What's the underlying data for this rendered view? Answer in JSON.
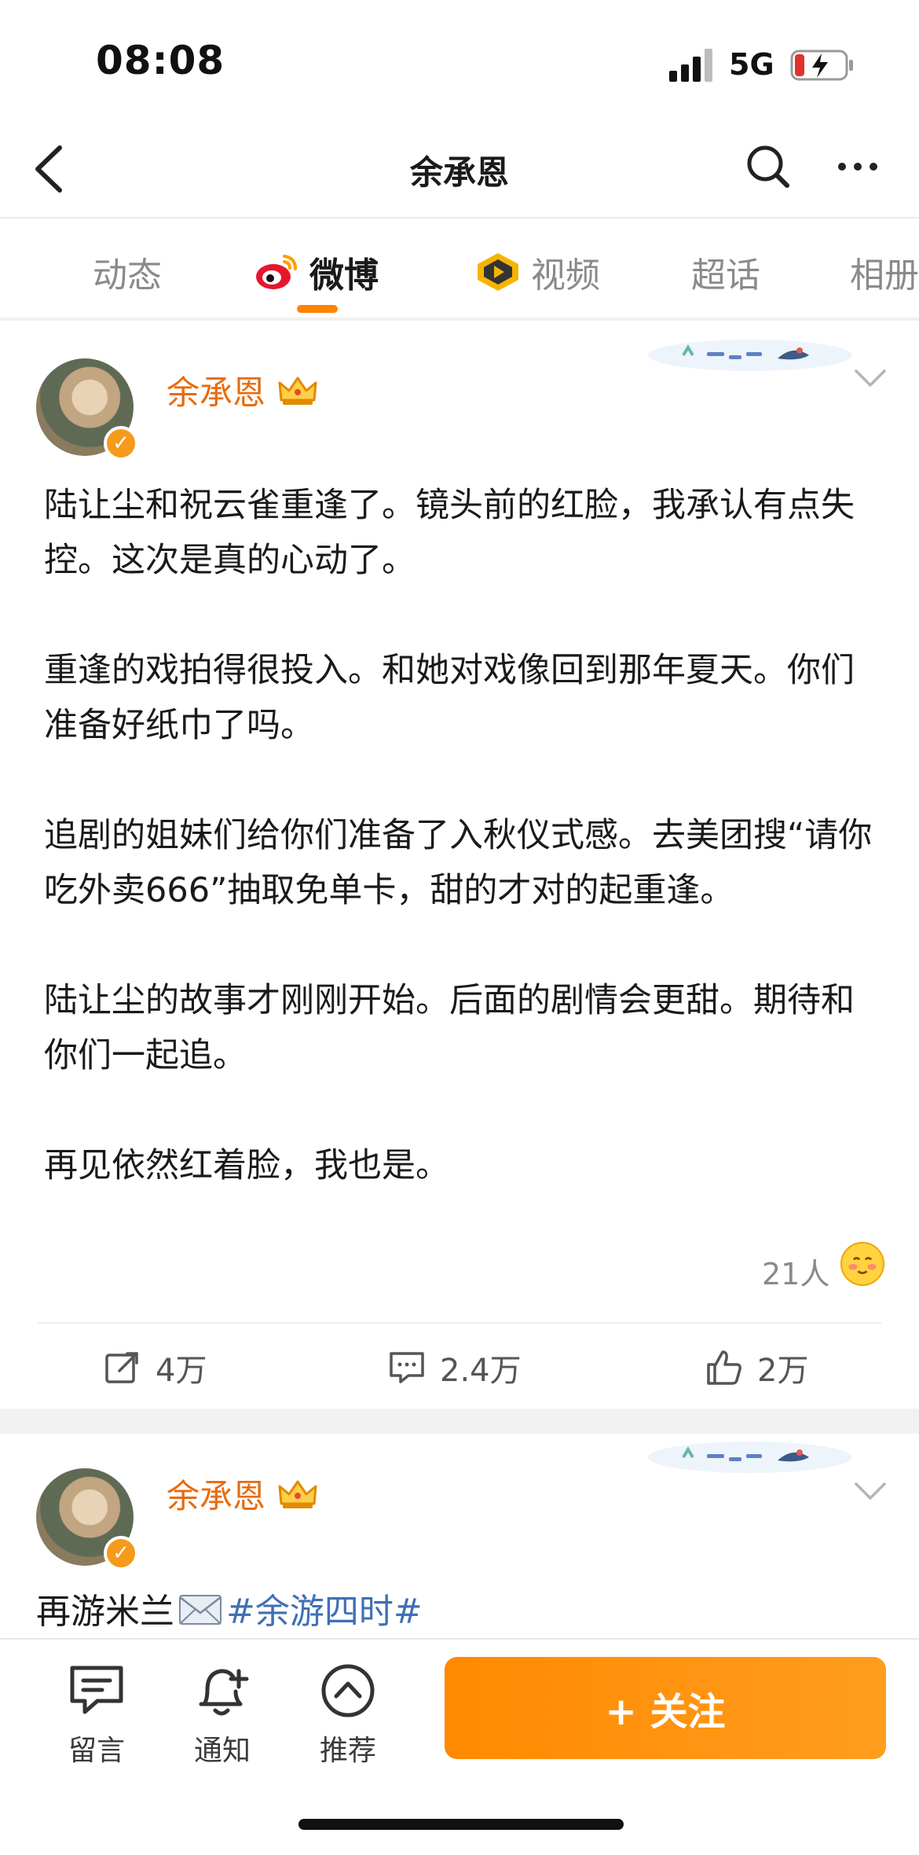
{
  "status_bar": {
    "time": "08:08",
    "network": "5G"
  },
  "nav": {
    "title": "余承恩"
  },
  "tabs": [
    {
      "label": "动态"
    },
    {
      "label": "微博"
    },
    {
      "label": "视频"
    },
    {
      "label": "超话"
    },
    {
      "label": "相册"
    }
  ],
  "post1": {
    "author": "余承恩",
    "paragraphs": [
      "陆让尘和祝云雀重逢了。镜头前的红脸，我承认有点失控。这次是真的心动了。",
      "重逢的戏拍得很投入。和她对戏像回到那年夏天。你们准备好纸巾了吗。",
      "追剧的姐妹们给你们准备了入秋仪式感。去美团搜“请你吃外卖666”抽取免单卡，甜的才对的起重逢。",
      "陆让尘的故事才刚刚开始。后面的剧情会更甜。期待和你们一起追。",
      "再见依然红着脸，我也是。"
    ],
    "reactions": "21人",
    "repost_count": "4万",
    "comment_count": "2.4万",
    "like_count": "2万"
  },
  "post2": {
    "author": "余承恩",
    "text": "再游米兰",
    "hashtag": "#余游四时#"
  },
  "bottom_bar": {
    "message_label": "留言",
    "notify_label": "通知",
    "recommend_label": "推荐",
    "follow_label": "+ 关注"
  },
  "colors": {
    "accent": "#ff8200",
    "name": "#e86b0c",
    "hashtag": "#3f6fb5"
  }
}
